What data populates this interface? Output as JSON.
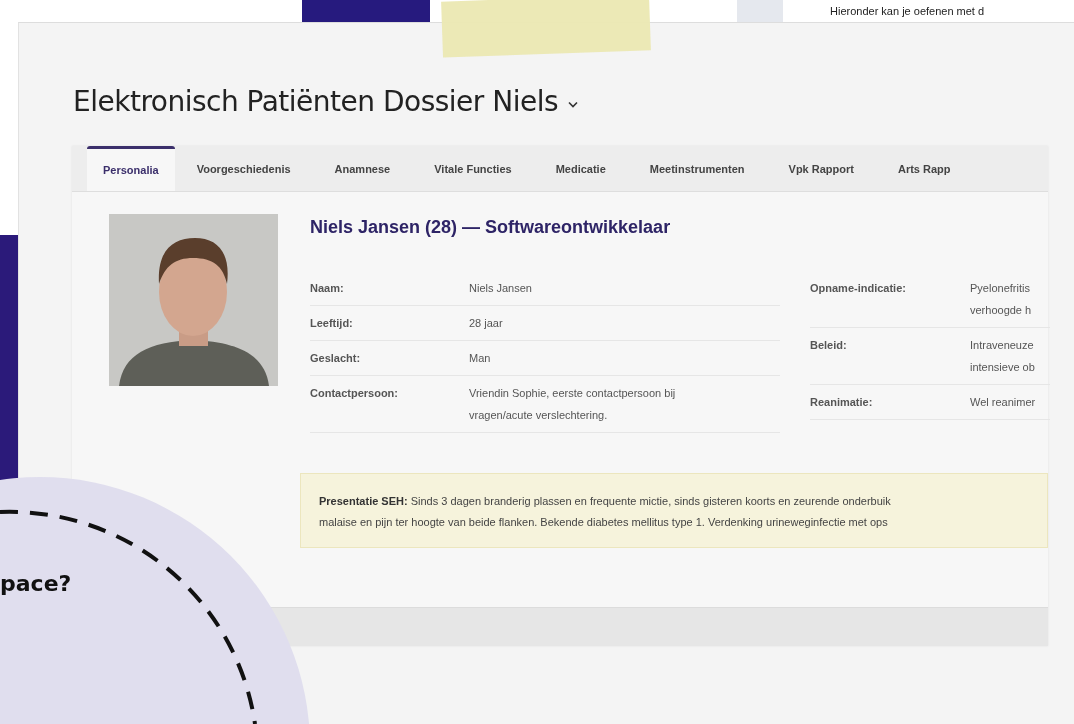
{
  "backdrop": {
    "intro_text": "Hieronder kan je oefenen met d",
    "bubble_text": "pace?"
  },
  "page": {
    "title": "Elektronisch Patiënten Dossier Niels"
  },
  "tabs": [
    {
      "label": "Personalia",
      "selected": true
    },
    {
      "label": "Voorgeschiedenis",
      "selected": false
    },
    {
      "label": "Anamnese",
      "selected": false
    },
    {
      "label": "Vitale Functies",
      "selected": false
    },
    {
      "label": "Medicatie",
      "selected": false
    },
    {
      "label": "Meetinstrumenten",
      "selected": false
    },
    {
      "label": "Vpk Rapport",
      "selected": false
    },
    {
      "label": "Arts Rapp",
      "selected": false
    }
  ],
  "patient": {
    "heading": "Niels Jansen (28) — Softwareontwikkelaar",
    "details": [
      {
        "label": "Naam:",
        "value": [
          "Niels Jansen"
        ]
      },
      {
        "label": "Leeftijd:",
        "value": [
          "28 jaar"
        ]
      },
      {
        "label": "Geslacht:",
        "value": [
          "Man"
        ]
      },
      {
        "label": "Contactpersoon:",
        "value": [
          "Vriendin Sophie, eerste contactpersoon bij",
          "vragen/acute verslechtering."
        ]
      }
    ],
    "admission": [
      {
        "label": "Opname-indicatie:",
        "value": [
          "Pyelonefritis",
          "verhoogde h"
        ]
      },
      {
        "label": "Beleid:",
        "value": [
          "Intraveneuze",
          "intensieve ob"
        ]
      },
      {
        "label": "Reanimatie:",
        "value": [
          "Wel reanimer"
        ]
      }
    ]
  },
  "presentation": {
    "lines": [
      "**Presentatie SEH:** Sinds 3 dagen branderig plassen en frequente mictie, sinds gisteren koorts en zeurende onderbuik",
      "malaise en pijn ter hoogte van beide flanken. Bekende diabetes mellitus type 1. Verdenking urineweginfectie met ops"
    ]
  }
}
